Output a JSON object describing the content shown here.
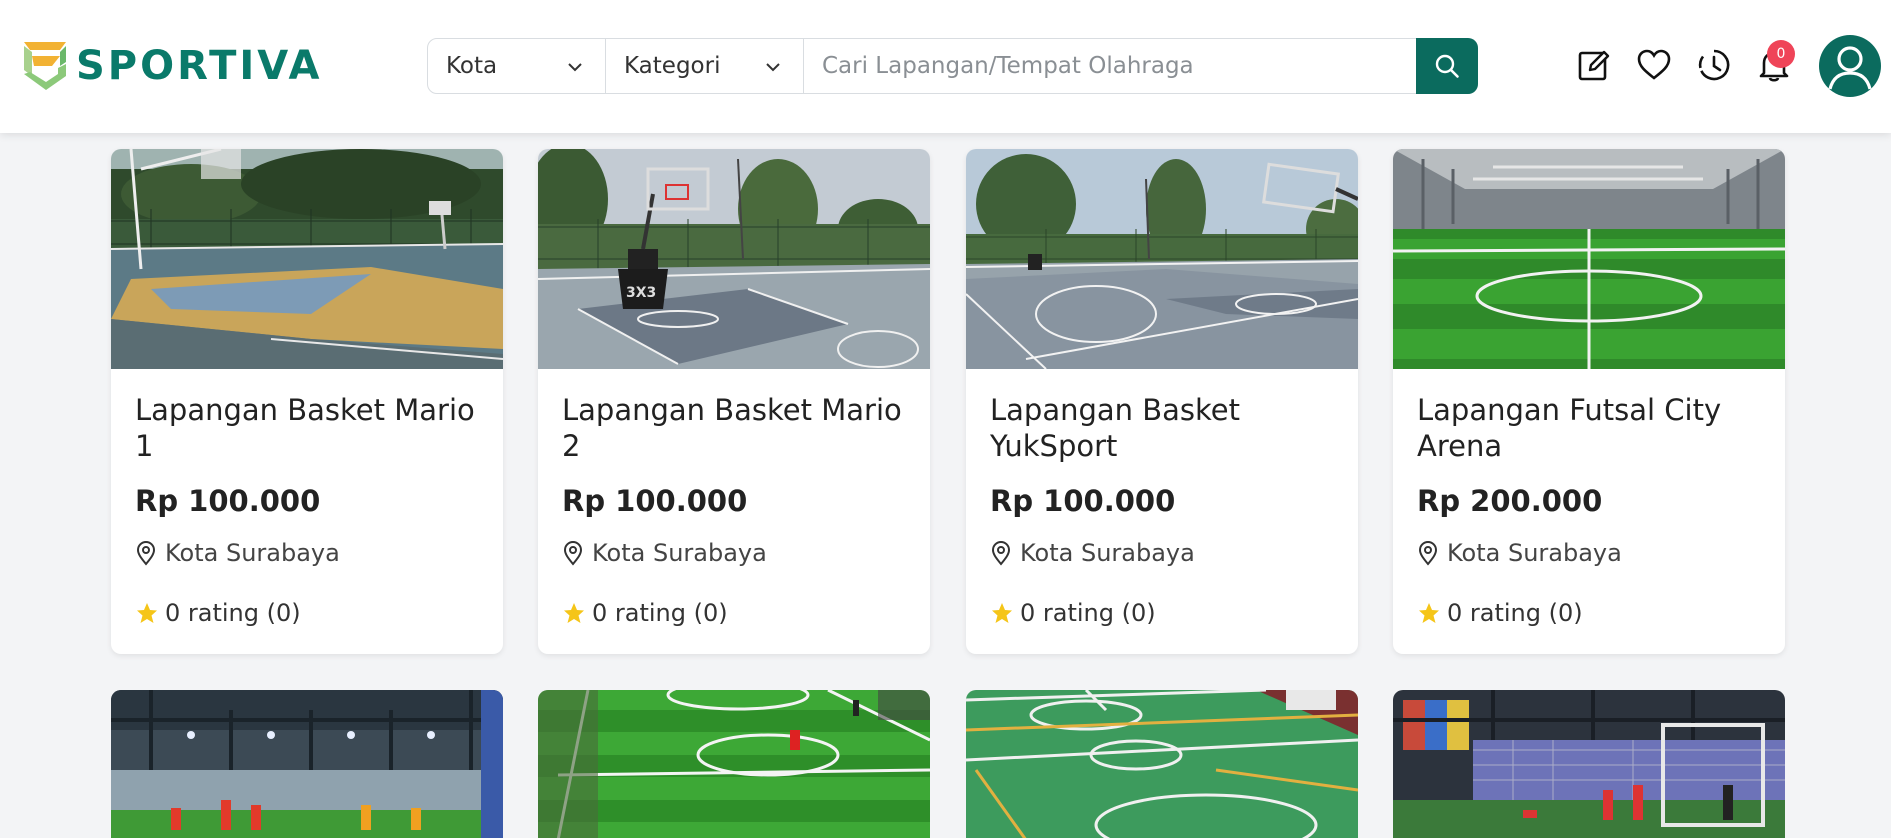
{
  "brand": {
    "name": "SPORTIVA",
    "color": "#0a7a6a"
  },
  "search": {
    "city_label": "Kota",
    "category_label": "Kategori",
    "placeholder": "Cari Lapangan/Tempat Olahraga",
    "button_icon": "search-icon"
  },
  "header_icons": [
    "edit-icon",
    "heart-icon",
    "history-icon",
    "bell-icon"
  ],
  "notifications": {
    "count": "0"
  },
  "user": {
    "avatar_icon": "user-icon"
  },
  "venues": [
    {
      "name": "Lapangan Basket Mario 1",
      "price": "Rp 100.000",
      "location": "Kota Surabaya",
      "rating": "0 rating (0)"
    },
    {
      "name": "Lapangan Basket Mario 2",
      "price": "Rp 100.000",
      "location": "Kota Surabaya",
      "rating": "0 rating (0)"
    },
    {
      "name": "Lapangan Basket YukSport",
      "price": "Rp 100.000",
      "location": "Kota Surabaya",
      "rating": "0 rating (0)"
    },
    {
      "name": "Lapangan Futsal City Arena",
      "price": "Rp 200.000",
      "location": "Kota Surabaya",
      "rating": "0 rating (0)"
    }
  ],
  "colors": {
    "accent": "#0b6b5e",
    "badge": "#ef4458",
    "star": "#f5c518",
    "background": "#f3f4f6"
  }
}
